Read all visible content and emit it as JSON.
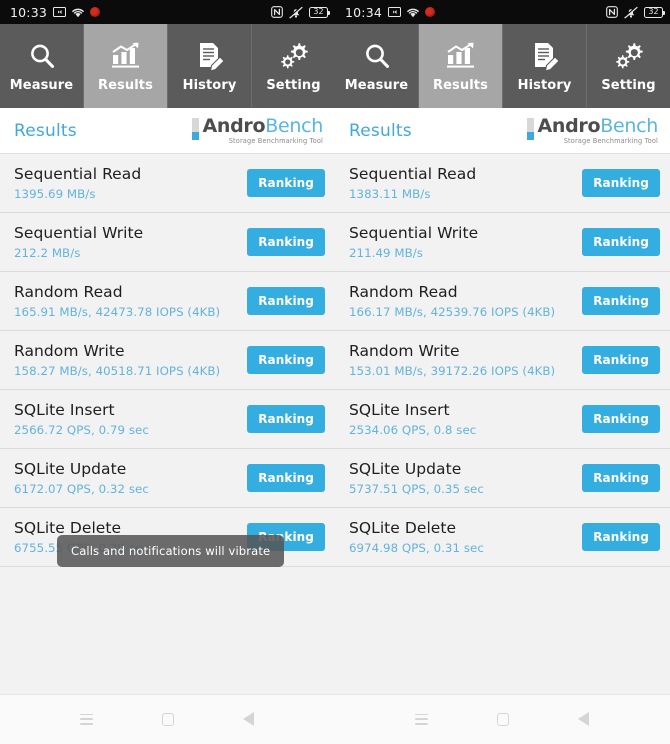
{
  "colors": {
    "accent": "#34ade0",
    "value_text": "#63b3dd",
    "tabbar_bg": "#5b5b5b",
    "tab_active_bg": "#a6a6a6",
    "row_bg": "#f2f2f2",
    "statusbar_bg": "#0b0b0b",
    "logo_blue": "#58b6e5",
    "logo_gray": "#4d4d4d"
  },
  "panels": [
    {
      "status_bar": {
        "time": "10:33",
        "left_icons": [
          "screenshot-icon",
          "wifi-icon",
          "record-icon"
        ],
        "right_icons": [
          "nfc-icon",
          "vibrate-icon",
          "battery-icon"
        ],
        "battery_level": "32"
      },
      "tabs": [
        {
          "label": "Measure",
          "icon": "magnifier-icon",
          "active": false
        },
        {
          "label": "Results",
          "icon": "bar-chart-icon",
          "active": true
        },
        {
          "label": "History",
          "icon": "document-edit-icon",
          "active": false
        },
        {
          "label": "Setting",
          "icon": "gears-icon",
          "active": false
        }
      ],
      "header": {
        "title": "Results",
        "logo_andro": "Andro",
        "logo_bench": "Bench",
        "logo_sub": "Storage Benchmarking Tool"
      },
      "rows": [
        {
          "title": "Sequential Read",
          "value": "1395.69 MB/s",
          "button": "Ranking"
        },
        {
          "title": "Sequential Write",
          "value": "212.2 MB/s",
          "button": "Ranking"
        },
        {
          "title": "Random Read",
          "value": "165.91 MB/s, 42473.78 IOPS (4KB)",
          "button": "Ranking"
        },
        {
          "title": "Random Write",
          "value": "158.27 MB/s, 40518.71 IOPS (4KB)",
          "button": "Ranking"
        },
        {
          "title": "SQLite Insert",
          "value": "2566.72 QPS, 0.79 sec",
          "button": "Ranking"
        },
        {
          "title": "SQLite Update",
          "value": "6172.07 QPS, 0.32 sec",
          "button": "Ranking"
        },
        {
          "title": "SQLite Delete",
          "value": "6755.55 QPS, 0.29 sec",
          "button": "Ranking"
        }
      ],
      "toast": "Calls and notifications will vibrate"
    },
    {
      "status_bar": {
        "time": "10:34",
        "left_icons": [
          "screenshot-icon",
          "wifi-icon",
          "record-icon"
        ],
        "right_icons": [
          "nfc-icon",
          "vibrate-icon",
          "battery-icon"
        ],
        "battery_level": "32"
      },
      "tabs": [
        {
          "label": "Measure",
          "icon": "magnifier-icon",
          "active": false
        },
        {
          "label": "Results",
          "icon": "bar-chart-icon",
          "active": true
        },
        {
          "label": "History",
          "icon": "document-edit-icon",
          "active": false
        },
        {
          "label": "Setting",
          "icon": "gears-icon",
          "active": false
        }
      ],
      "header": {
        "title": "Results",
        "logo_andro": "Andro",
        "logo_bench": "Bench",
        "logo_sub": "Storage Benchmarking Tool"
      },
      "rows": [
        {
          "title": "Sequential Read",
          "value": "1383.11 MB/s",
          "button": "Ranking"
        },
        {
          "title": "Sequential Write",
          "value": "211.49 MB/s",
          "button": "Ranking"
        },
        {
          "title": "Random Read",
          "value": "166.17 MB/s, 42539.76 IOPS (4KB)",
          "button": "Ranking"
        },
        {
          "title": "Random Write",
          "value": "153.01 MB/s, 39172.26 IOPS (4KB)",
          "button": "Ranking"
        },
        {
          "title": "SQLite Insert",
          "value": "2534.06 QPS, 0.8 sec",
          "button": "Ranking"
        },
        {
          "title": "SQLite Update",
          "value": "5737.51 QPS, 0.35 sec",
          "button": "Ranking"
        },
        {
          "title": "SQLite Delete",
          "value": "6974.98 QPS, 0.31 sec",
          "button": "Ranking"
        }
      ],
      "toast": null
    }
  ],
  "nav_bar": {
    "buttons": [
      {
        "name": "recents-icon"
      },
      {
        "name": "home-icon"
      },
      {
        "name": "back-icon"
      }
    ]
  }
}
